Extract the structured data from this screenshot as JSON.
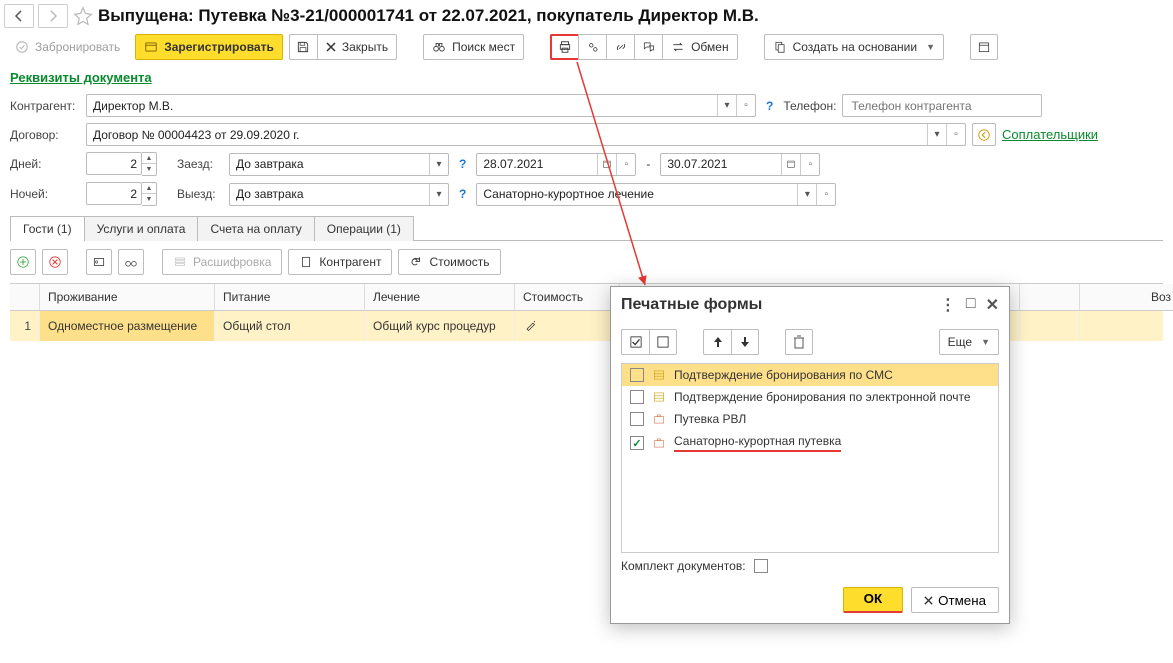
{
  "header": {
    "title": "Выпущена: Путевка №3-21/000001741 от 22.07.2021, покупатель Директор М.В."
  },
  "toolbar": {
    "book_label": "Забронировать",
    "register_label": "Зарегистрировать",
    "close_label": "Закрыть",
    "search_places_label": "Поиск мест",
    "exchange_label": "Обмен",
    "create_based_label": "Создать на основании"
  },
  "links": {
    "doc_props": "Реквизиты документа",
    "copayers": "Соплательщики"
  },
  "form": {
    "contragent_label": "Контрагент:",
    "contragent_value": "Директор М.В.",
    "contract_label": "Договор:",
    "contract_value": "Договор № 00004423 от 29.09.2020 г.",
    "days_label": "Дней:",
    "days_value": "2",
    "nights_label": "Ночей:",
    "nights_value": "2",
    "checkin_label": "Заезд:",
    "checkin_value": "До завтрака",
    "checkout_label": "Выезд:",
    "checkout_value": "До завтрака",
    "date_from": "28.07.2021",
    "date_to": "30.07.2021",
    "treatment_type": "Санаторно-курортное лечение",
    "phone_label": "Телефон:",
    "phone_placeholder": "Телефон контрагента"
  },
  "tabs": {
    "guests": "Гости (1)",
    "services": "Услуги и оплата",
    "bills": "Счета на оплату",
    "ops": "Операции (1)"
  },
  "tab_toolbar": {
    "decode": "Расшифровка",
    "contragent": "Контрагент",
    "price": "Стоимость"
  },
  "grid": {
    "col_living": "Проживание",
    "col_food": "Питание",
    "col_treatment": "Лечение",
    "col_price": "Стоимость",
    "col_age": "Воз",
    "row_num": "1",
    "row_living": "Одноместное размещение",
    "row_food": "Общий стол",
    "row_treatment": "Общий курс процедур"
  },
  "dialog": {
    "title": "Печатные формы",
    "more": "Еще",
    "items": [
      "Подтверждение бронирования по СМС",
      "Подтверждение бронирования по электронной почте",
      "Путевка РВЛ",
      "Санаторно-курортная путевка"
    ],
    "docset_label": "Комплект документов:",
    "ok": "ОК",
    "cancel": "Отмена"
  }
}
